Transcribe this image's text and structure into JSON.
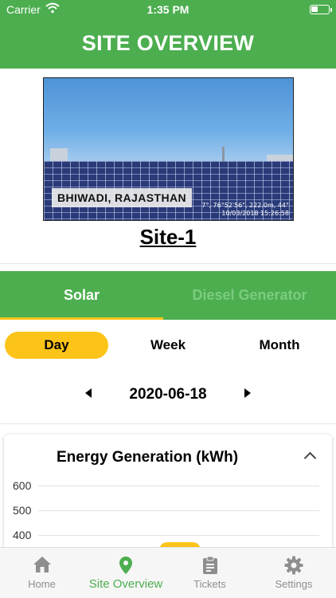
{
  "status_bar": {
    "carrier": "Carrier",
    "time": "1:35 PM"
  },
  "header": {
    "title": "SITE OVERVIEW"
  },
  "site": {
    "photo_location": "BHIWADI, RAJASTHAN",
    "photo_stamp_line1": "7°, 76°52'56\", 222.0m, 44°",
    "photo_stamp_line2": "10/03/2018 15:26:58",
    "name": "Site-1"
  },
  "tabs": [
    {
      "label": "Solar"
    },
    {
      "label": "Diesel Generator"
    }
  ],
  "periods": [
    {
      "label": "Day"
    },
    {
      "label": "Week"
    },
    {
      "label": "Month"
    }
  ],
  "date_nav": {
    "date": "2020-06-18"
  },
  "chart_data": {
    "type": "bar",
    "title": "Energy Generation (kWh)",
    "y_ticks": [
      "600",
      "500",
      "400"
    ],
    "ylim": [
      400,
      600
    ],
    "grid": true,
    "categories": [],
    "values": []
  },
  "bottom_nav": [
    {
      "label": "Home",
      "icon": "home-icon"
    },
    {
      "label": "Site Overview",
      "icon": "map-pin-icon"
    },
    {
      "label": "Tickets",
      "icon": "clipboard-icon"
    },
    {
      "label": "Settings",
      "icon": "gear-icon"
    }
  ],
  "colors": {
    "brand_green": "#4cae4f",
    "accent_yellow": "#fcc419",
    "inactive_tab_text": "#7ccc80",
    "nav_inactive": "#8e8e8e"
  }
}
